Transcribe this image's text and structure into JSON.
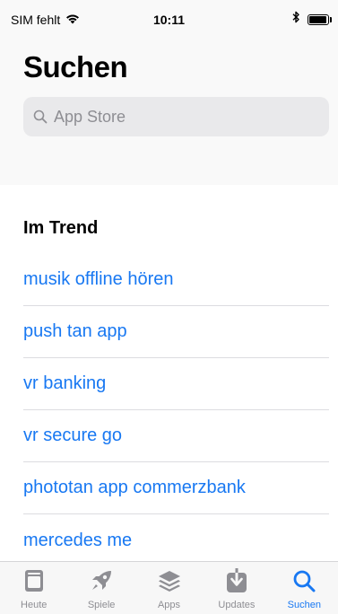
{
  "status_bar": {
    "carrier": "SIM fehlt",
    "time": "10:11",
    "battery_level": 0.85
  },
  "header": {
    "title": "Suchen"
  },
  "search": {
    "placeholder": "App Store"
  },
  "trending": {
    "title": "Im Trend",
    "items": [
      "musik offline hören",
      "push tan app",
      "vr banking",
      "vr secure go",
      "phototan app commerzbank",
      "mercedes me"
    ]
  },
  "tab_bar": {
    "tabs": [
      {
        "label": "Heute",
        "icon": "today-icon"
      },
      {
        "label": "Spiele",
        "icon": "rocket-icon"
      },
      {
        "label": "Apps",
        "icon": "layers-icon"
      },
      {
        "label": "Updates",
        "icon": "download-icon"
      },
      {
        "label": "Suchen",
        "icon": "search-icon"
      }
    ],
    "active_index": 4
  },
  "colors": {
    "accent": "#1878f2",
    "inactive": "#8e8e93"
  }
}
